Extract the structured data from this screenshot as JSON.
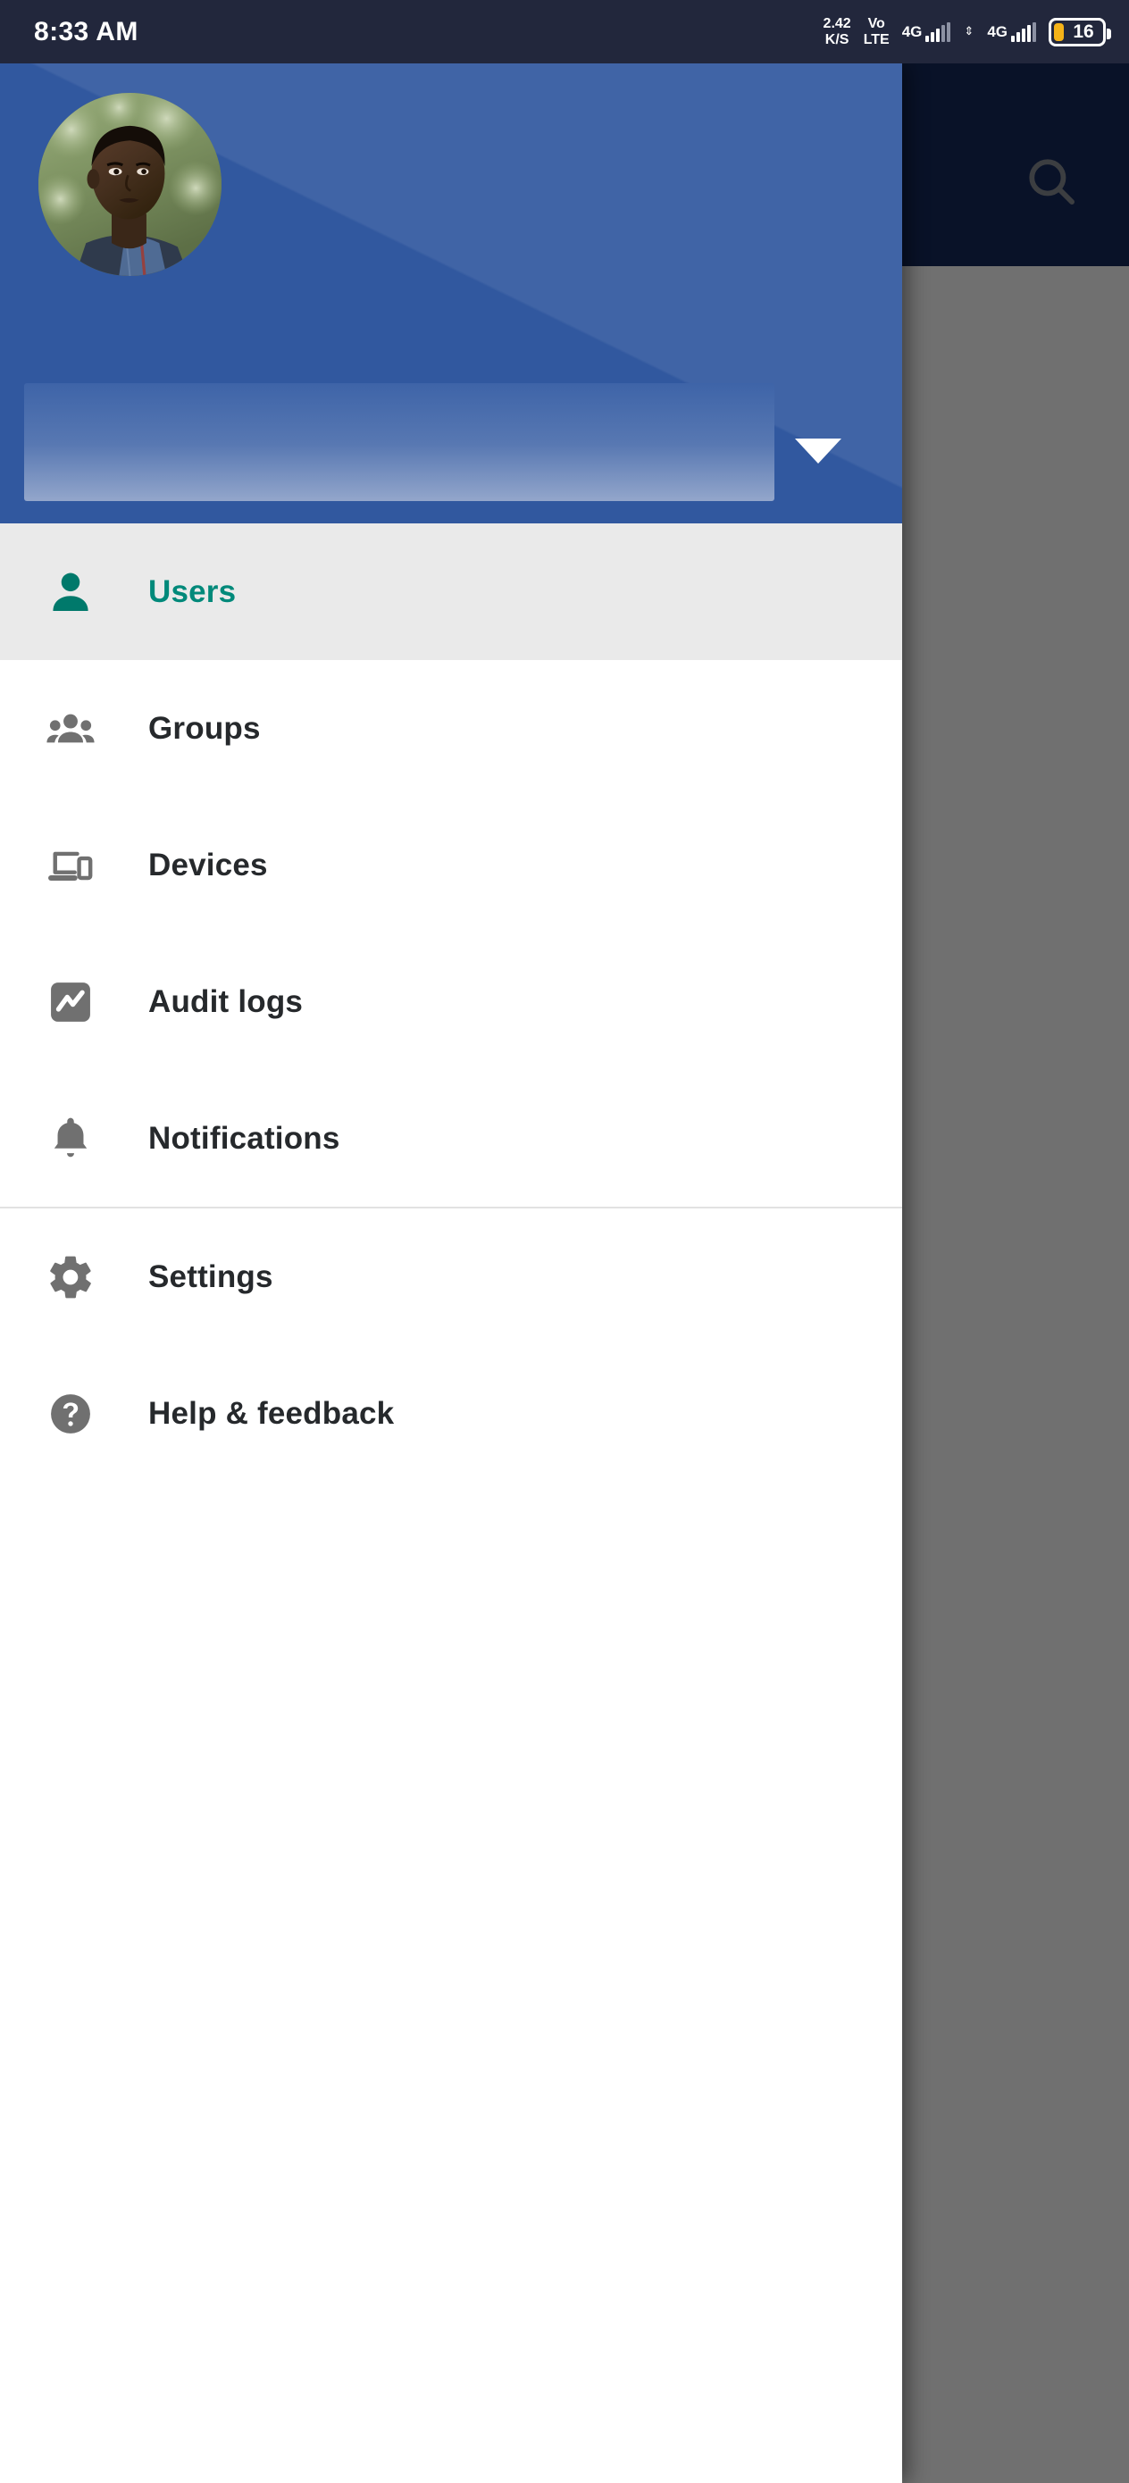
{
  "status_bar": {
    "time": "8:33 AM",
    "data_rate_value": "2.42",
    "data_rate_unit": "K/S",
    "volte_line1": "Vo",
    "volte_line2": "LTE",
    "sim1_network": "4G",
    "sim2_network": "4G",
    "battery_percent": "16",
    "battery_color": "#f5b318"
  },
  "app_bar": {
    "search_icon": "search-icon"
  },
  "drawer": {
    "header": {
      "avatar_alt": "user-profile-photo",
      "account_name": "",
      "account_email": "",
      "expand_icon": "chevron-down-icon",
      "background_color": "#31589f"
    },
    "items": [
      {
        "label": "Users",
        "icon": "person-icon",
        "selected": true
      },
      {
        "label": "Groups",
        "icon": "people-group-icon",
        "selected": false
      },
      {
        "label": "Devices",
        "icon": "devices-icon",
        "selected": false
      },
      {
        "label": "Audit logs",
        "icon": "audit-chart-icon",
        "selected": false
      },
      {
        "label": "Notifications",
        "icon": "bell-icon",
        "selected": false
      }
    ],
    "secondary_items": [
      {
        "label": "Settings",
        "icon": "gear-icon",
        "selected": false
      },
      {
        "label": "Help & feedback",
        "icon": "help-circle-icon",
        "selected": false
      }
    ],
    "selected_color": "#00897a",
    "selected_row_bg": "#eaeaea",
    "icon_color": "#707070"
  }
}
